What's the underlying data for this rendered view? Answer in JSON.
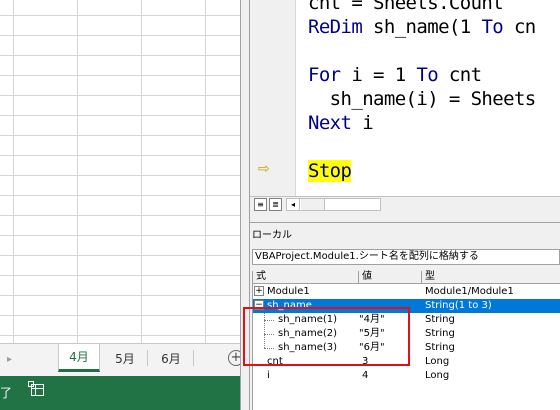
{
  "excel": {
    "tab_scroll_glyph": "▸",
    "sheet_tabs": [
      "4月",
      "5月",
      "6月"
    ],
    "active_tab": "4月",
    "add_sheet_glyph": "+",
    "status_text": "了"
  },
  "code": {
    "lines": [
      {
        "text": "cnt = Sheets.Count"
      },
      {
        "kw": "ReDim",
        "text": " sh_name(1 ",
        "kw2": "To",
        "text2": " cn"
      },
      {
        "kw": "For",
        "text": " i = 1 ",
        "kw2": "To",
        "text2": " cnt"
      },
      {
        "text": "  sh_name(i) = Sheets"
      },
      {
        "kw": "Next",
        "text": " i"
      },
      {
        "kw": "Stop",
        "highlight": true
      }
    ],
    "execution_arrow": "⇨"
  },
  "code_footer": {
    "view_buttons": [
      "≡",
      "≣"
    ],
    "scroll_left": "◂"
  },
  "locals": {
    "title": "ローカル",
    "context": "VBAProject.Module1.シート名を配列に格納する",
    "columns": [
      "式",
      "値",
      "型"
    ],
    "rows": [
      {
        "expr": "Module1",
        "value": "",
        "type": "Module1/Module1",
        "expander": "+",
        "selected": false
      },
      {
        "expr": "sh_name",
        "value": "",
        "type": "String(1 to 3)",
        "expander": "−",
        "selected": true
      },
      {
        "expr": "sh_name(1)",
        "value": "\"4月\"",
        "type": "String",
        "selected": false
      },
      {
        "expr": "sh_name(2)",
        "value": "\"5月\"",
        "type": "String",
        "selected": false
      },
      {
        "expr": "sh_name(3)",
        "value": "\"6月\"",
        "type": "String",
        "selected": false
      },
      {
        "expr": "cnt",
        "value": "3",
        "type": "Long",
        "selected": false
      },
      {
        "expr": "i",
        "value": "4",
        "type": "Long",
        "selected": false
      }
    ]
  },
  "colors": {
    "excel_green": "#217346",
    "selection_blue": "#0078d7",
    "keyword_blue": "#00008b",
    "highlight_yellow": "#ffff00",
    "callout_red": "#e0101a"
  }
}
